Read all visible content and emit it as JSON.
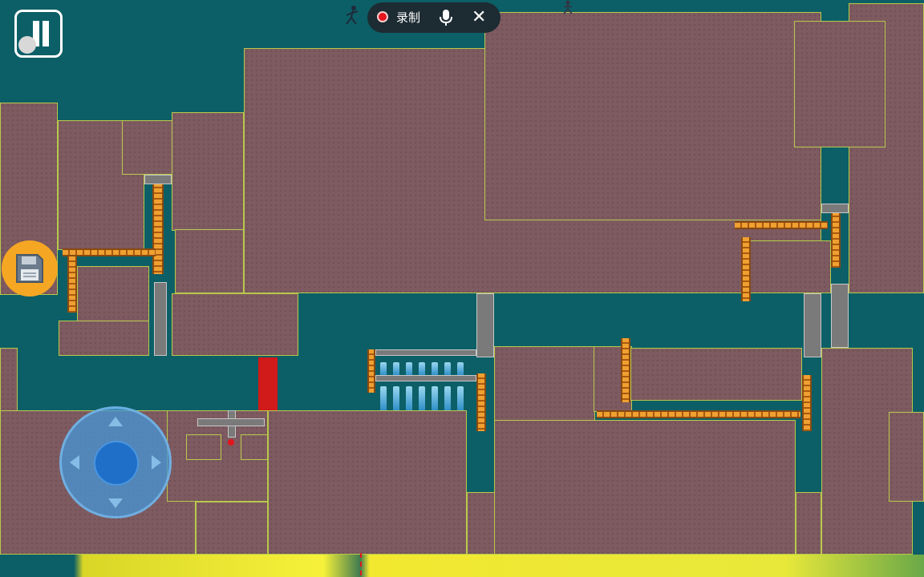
{
  "recording": {
    "label": "录制",
    "status_color": "#e3151d",
    "mic_icon": "microphone-icon",
    "close_icon": "close-icon",
    "close_glyph": "✕"
  },
  "controls": {
    "pause_icon": "pause-icon",
    "save_icon": "floppy-disk-icon",
    "joystick_icon": "dpad-joystick-icon"
  },
  "level_progress": {
    "player_position_fraction": 0.39,
    "colors": {
      "water": "#0c5f66",
      "block": "#7e5b61",
      "block_edge": "#b8c94a",
      "ladder": "#f0a030",
      "hazard": "#e3151d",
      "spike": "#2f8fc8"
    }
  }
}
